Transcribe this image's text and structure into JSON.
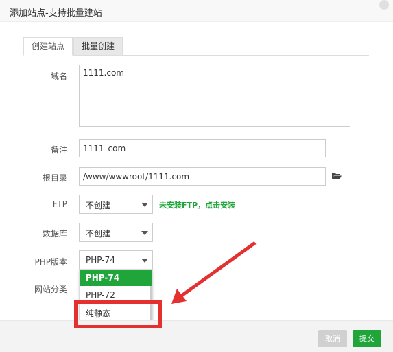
{
  "dialog": {
    "title": "添加站点-支持批量建站"
  },
  "tabs": [
    {
      "label": "创建站点",
      "active": true
    },
    {
      "label": "批量创建",
      "active": false
    }
  ],
  "form": {
    "domain_label": "域名",
    "domain_value": "1111.com",
    "remark_label": "备注",
    "remark_value": "1111_com",
    "root_label": "根目录",
    "root_value": "/www/wwwroot/1111.com",
    "ftp_label": "FTP",
    "ftp_value": "不创建",
    "ftp_hint": "未安装FTP，点击安装",
    "db_label": "数据库",
    "db_value": "不创建",
    "php_label": "PHP版本",
    "php_value": "PHP-74",
    "category_label": "网站分类"
  },
  "php_dropdown": {
    "options": [
      "PHP-74",
      "PHP-72",
      "纯静态"
    ],
    "selected": "PHP-74"
  },
  "footer": {
    "cancel_label": "取消",
    "submit_label": "提交"
  },
  "colors": {
    "accent": "#20a53a",
    "highlight": "#e53030"
  }
}
